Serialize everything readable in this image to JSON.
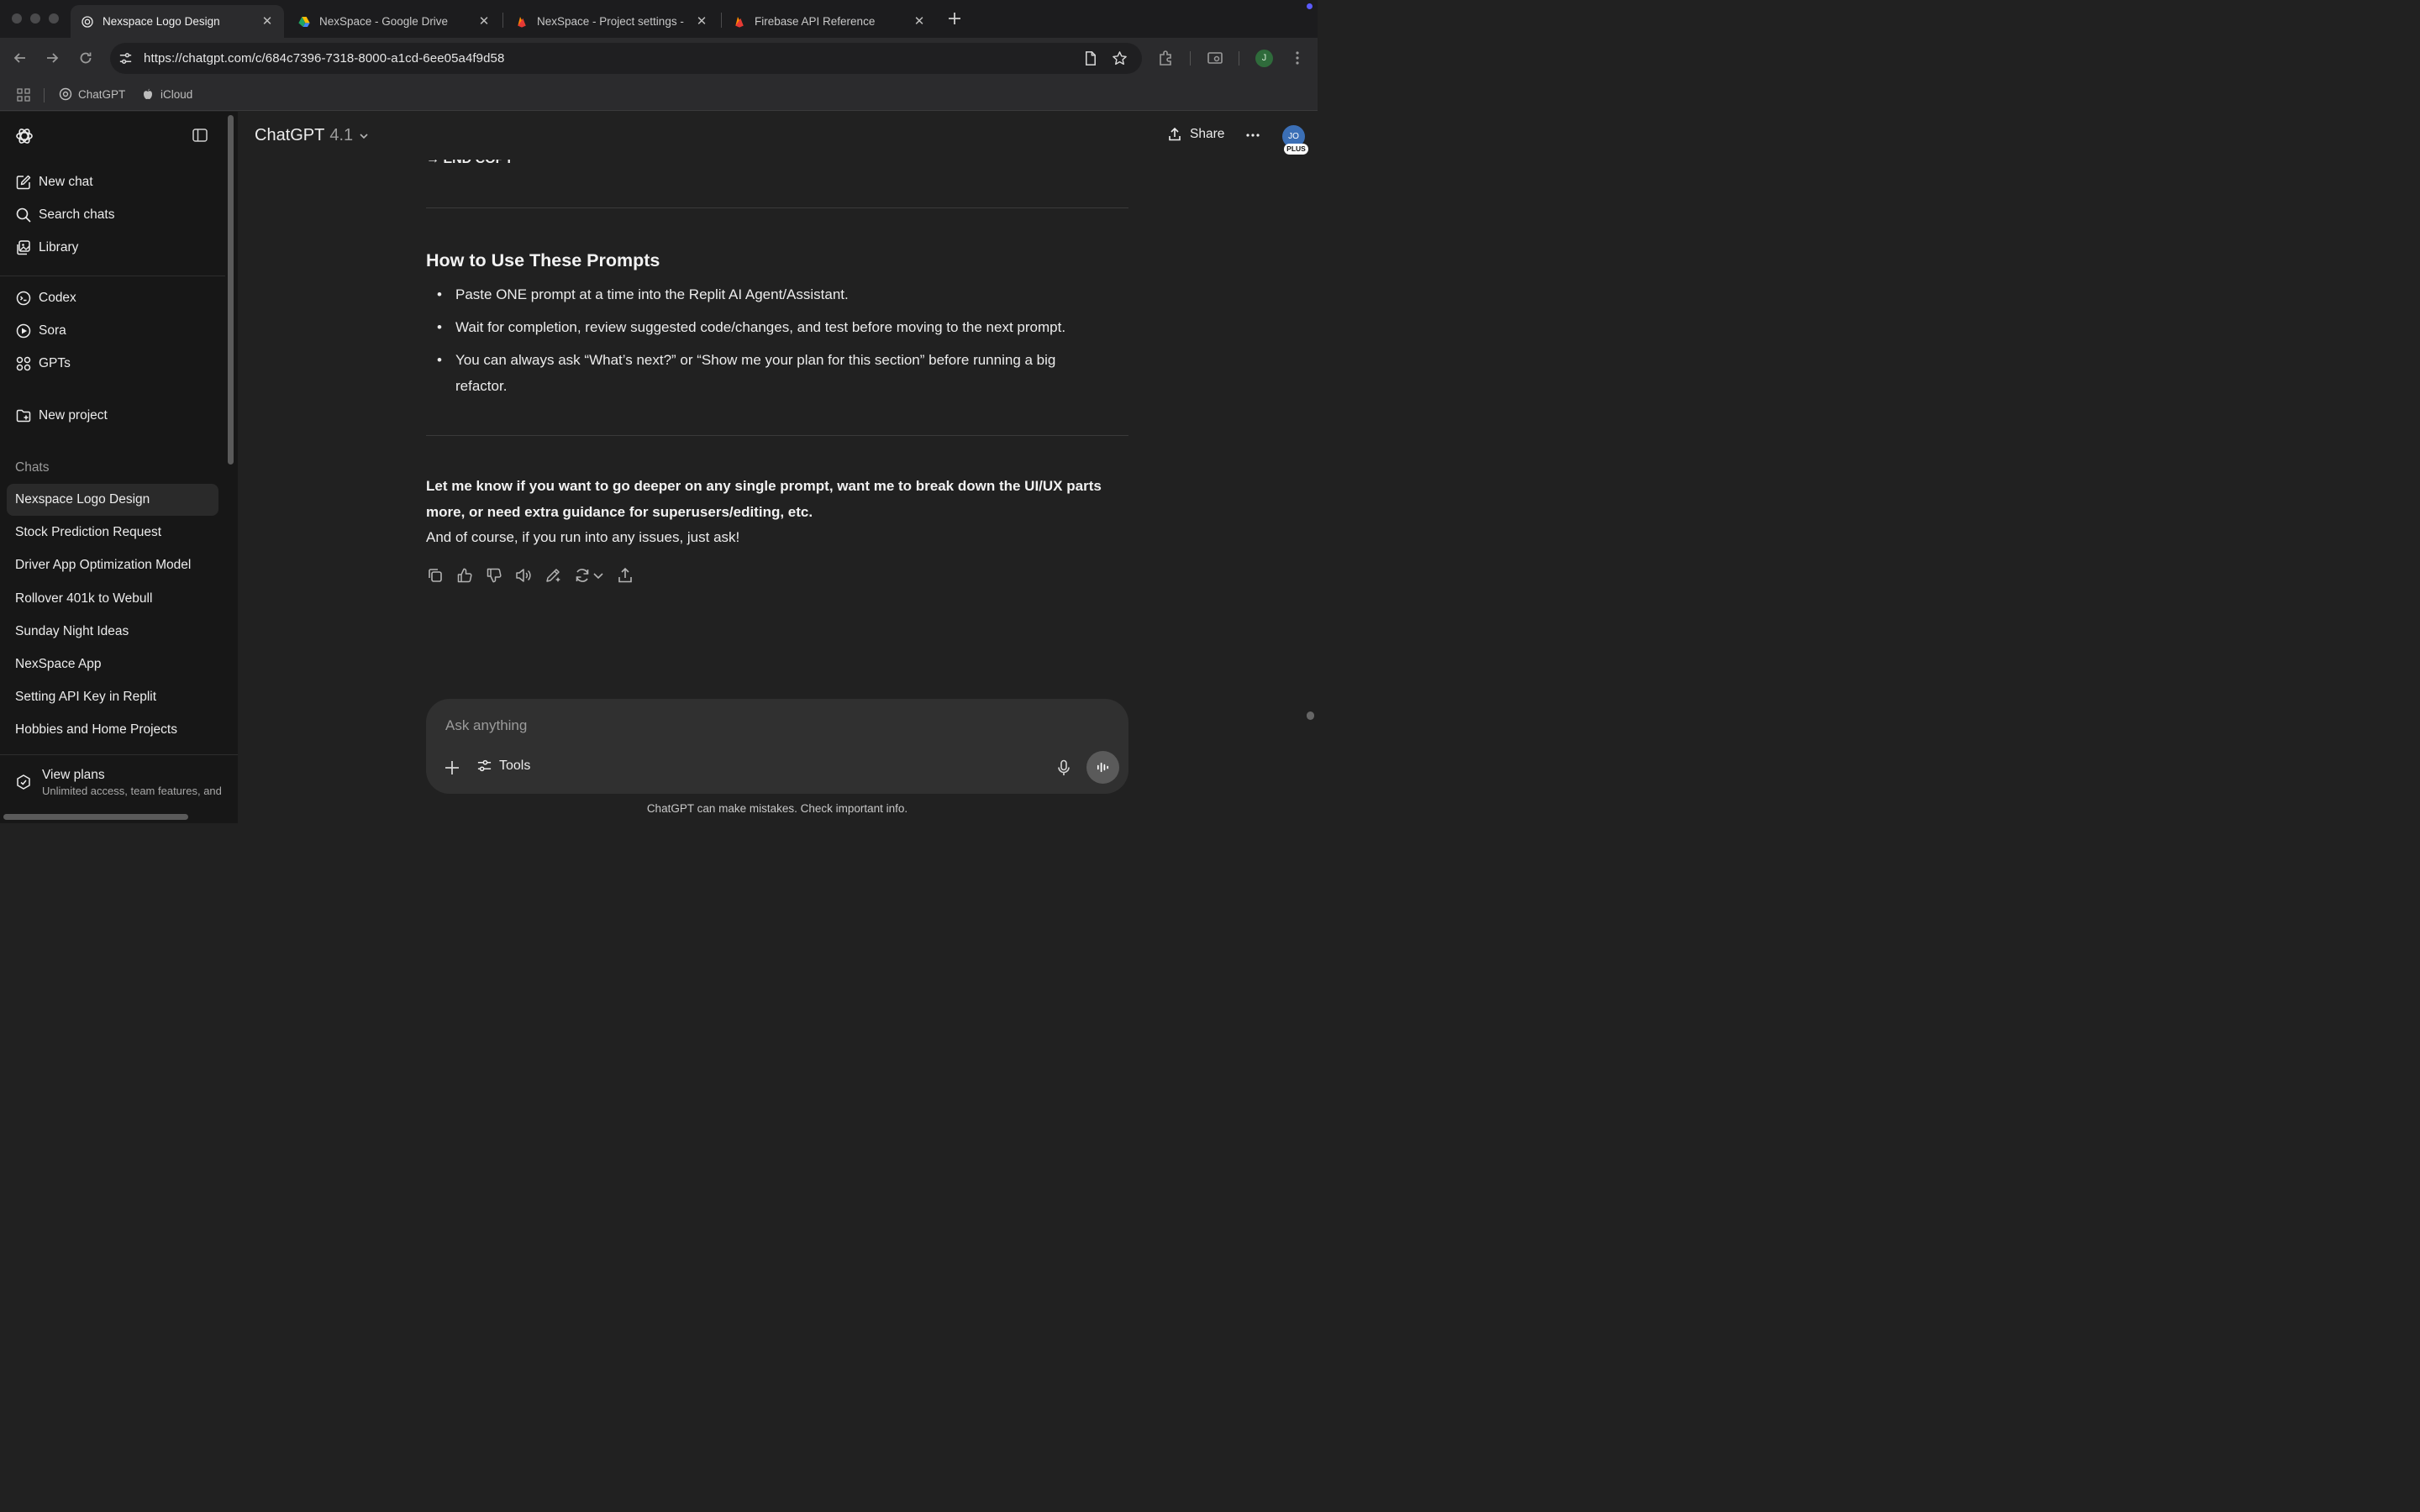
{
  "browser": {
    "tabs": [
      {
        "title": "Nexspace Logo Design",
        "favicon": "chatgpt-icon",
        "active": true
      },
      {
        "title": "NexSpace - Google Drive",
        "favicon": "google-drive-icon",
        "active": false
      },
      {
        "title": "NexSpace - Project settings -",
        "favicon": "firebase-icon",
        "active": false
      },
      {
        "title": "Firebase API Reference",
        "favicon": "firebase-icon",
        "active": false
      }
    ],
    "url": "https://chatgpt.com/c/684c7396-7318-8000-a1cd-6ee05a4f9d58",
    "profile_initial": "J",
    "bookmarks": [
      {
        "label": "ChatGPT",
        "icon": "chatgpt-icon"
      },
      {
        "label": "iCloud",
        "icon": "apple-icon"
      }
    ]
  },
  "sidebar": {
    "top_items": [
      {
        "label": "New chat",
        "icon": "edit-icon"
      },
      {
        "label": "Search chats",
        "icon": "search-icon"
      },
      {
        "label": "Library",
        "icon": "library-icon"
      }
    ],
    "app_items": [
      {
        "label": "Codex",
        "icon": "codex-icon"
      },
      {
        "label": "Sora",
        "icon": "sora-icon"
      },
      {
        "label": "GPTs",
        "icon": "gpts-icon"
      }
    ],
    "new_project": "New project",
    "chats_heading": "Chats",
    "chats": [
      "Nexspace Logo Design",
      "Stock Prediction Request",
      "Driver App Optimization Model",
      "Rollover 401k to Webull",
      "Sunday Night Ideas",
      "NexSpace App",
      "Setting API Key in Replit",
      "Hobbies and Home Projects"
    ],
    "active_chat": "Nexspace Logo Design",
    "plans_title": "View plans",
    "plans_subtitle": "Unlimited access, team features, and more"
  },
  "header": {
    "model_name": "ChatGPT",
    "model_version": "4.1",
    "share_label": "Share",
    "avatar_initials": "JO",
    "plan_badge": "PLUS"
  },
  "message": {
    "end_copy": "→ END COPY",
    "heading": "How to Use These Prompts",
    "bullets": [
      "Paste ONE prompt at a time into the Replit AI Agent/Assistant.",
      "Wait for completion, review suggested code/changes, and test before moving to the next prompt.",
      "You can always ask “What’s next?” or “Show me your plan for this section” before running a big refactor."
    ],
    "closing_bold": "Let me know if you want to go deeper on any single prompt, want me to break down the UI/UX parts more, or need extra guidance for superusers/editing, etc.",
    "closing": "And of course, if you run into any issues, just ask!",
    "actions": [
      "copy-icon",
      "thumbs-up-icon",
      "thumbs-down-icon",
      "read-aloud-icon",
      "edit-canvas-icon",
      "regenerate-icon",
      "share-icon"
    ]
  },
  "composer": {
    "placeholder": "Ask anything",
    "tools_label": "Tools"
  },
  "disclaimer": "ChatGPT can make mistakes. Check important info."
}
